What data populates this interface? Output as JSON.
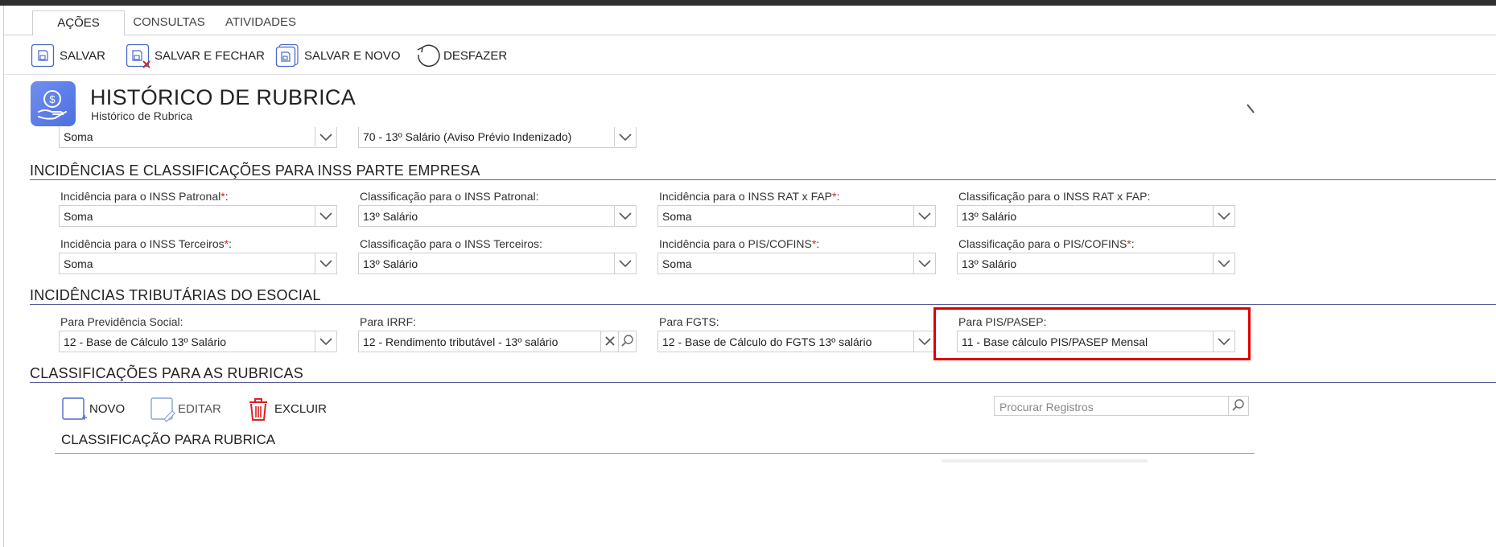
{
  "tabs": [
    "AÇÕES",
    "CONSULTAS",
    "ATIVIDADES"
  ],
  "toolbar": {
    "save": "SALVAR",
    "save_close": "SALVAR E FECHAR",
    "save_new": "SALVAR E NOVO",
    "undo": "DESFAZER"
  },
  "header": {
    "title": "HISTÓRICO DE RUBRICA",
    "subtitle": "Histórico de Rubrica"
  },
  "prev_row": {
    "field1": "Soma",
    "field2": "70 - 13º Salário (Aviso Prévio Indenizado)"
  },
  "inss": {
    "title": "INCIDÊNCIAS E CLASSIFICAÇÕES PARA INSS PARTE EMPRESA",
    "fields": [
      {
        "label": "Incidência para o INSS Patronal",
        "value": "Soma",
        "required": "*"
      },
      {
        "label": "Classificação para o INSS Patronal:",
        "value": "13º Salário",
        "required": ""
      },
      {
        "label": "Incidência para o INSS RAT x FAP",
        "value": "Soma",
        "required": "*"
      },
      {
        "label": "Classificação para o INSS RAT x FAP:",
        "value": "13º Salário",
        "required": ""
      },
      {
        "label": "Incidência para o INSS Terceiros",
        "value": "Soma",
        "required": "*"
      },
      {
        "label": "Classificação para o INSS Terceiros:",
        "value": "13º Salário",
        "required": ""
      },
      {
        "label": "Incidência para o PIS/COFINS",
        "value": "Soma",
        "required": "*"
      },
      {
        "label": "Classificação para o PIS/COFINS",
        "value": "13º Salário",
        "required": "*"
      }
    ]
  },
  "esocial": {
    "title": "INCIDÊNCIAS TRIBUTÁRIAS DO ESOCIAL",
    "fields": [
      {
        "label": "Para Previdência Social:",
        "value": "12 - Base de Cálculo 13º Salário"
      },
      {
        "label": "Para IRRF:",
        "value": "12 - Rendimento tributável - 13º salário"
      },
      {
        "label": "Para FGTS:",
        "value": "12 - Base de Cálculo do FGTS 13º salário"
      },
      {
        "label": "Para PIS/PASEP:",
        "value": "11 - Base cálculo PIS/PASEP Mensal"
      }
    ]
  },
  "classificacoes": {
    "title": "CLASSIFICAÇÕES PARA AS RUBRICAS",
    "new": "NOVO",
    "edit": "EDITAR",
    "delete": "EXCLUIR",
    "search_placeholder": "Procurar Registros",
    "subtitle": "CLASSIFICAÇÃO PARA RUBRICA"
  },
  "colors": {
    "accent": "#4d6fe0",
    "section_line": "#5b5b9c",
    "required": "#e21a1a",
    "highlight": "#e00000",
    "delete": "#e02020"
  }
}
